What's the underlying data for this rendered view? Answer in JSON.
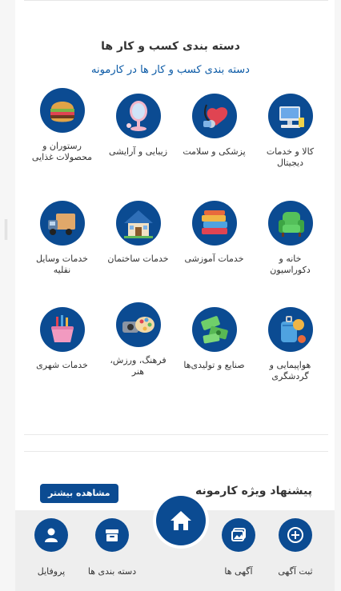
{
  "section": {
    "title": "دسته بندی کسب و کار ها",
    "subtitle": "دسته بندی کسب و کار ها در کارمونه"
  },
  "categories": [
    {
      "label": "کالا و خدمات دیجیتال",
      "icon": "computer-icon"
    },
    {
      "label": "پزشکی و سلامت",
      "icon": "stethoscope-icon"
    },
    {
      "label": "زیبایی و آرایشی",
      "icon": "mirror-icon"
    },
    {
      "label": "رستوران و محصولات غذایی",
      "icon": "burger-icon"
    },
    {
      "label": "خانه و دکوراسیون",
      "icon": "armchair-icon"
    },
    {
      "label": "خدمات آموزشی",
      "icon": "books-icon"
    },
    {
      "label": "خدمات ساختمان",
      "icon": "house-icon"
    },
    {
      "label": "خدمات وسایل نقلیه",
      "icon": "truck-icon"
    },
    {
      "label": "هواپیمایی و گردشگری",
      "icon": "suitcase-icon"
    },
    {
      "label": "صنایع و تولیدی‌ها",
      "icon": "money-icon"
    },
    {
      "label": "فرهنگ، ورزش، هنر",
      "icon": "palette-icon"
    },
    {
      "label": "خدمات شهری",
      "icon": "basket-icon"
    }
  ],
  "offers": {
    "title": "پیشنهاد ویژه کارمونه",
    "more_label": "مشاهده بیشتر"
  },
  "nav": {
    "post_ad": "ثبت آگهی",
    "ads": "آگهی ها",
    "categories": "دسته بندی ها",
    "profile": "پروفایل"
  },
  "colors": {
    "primary": "#0b4b92",
    "subtitle": "#0b5aa6"
  }
}
